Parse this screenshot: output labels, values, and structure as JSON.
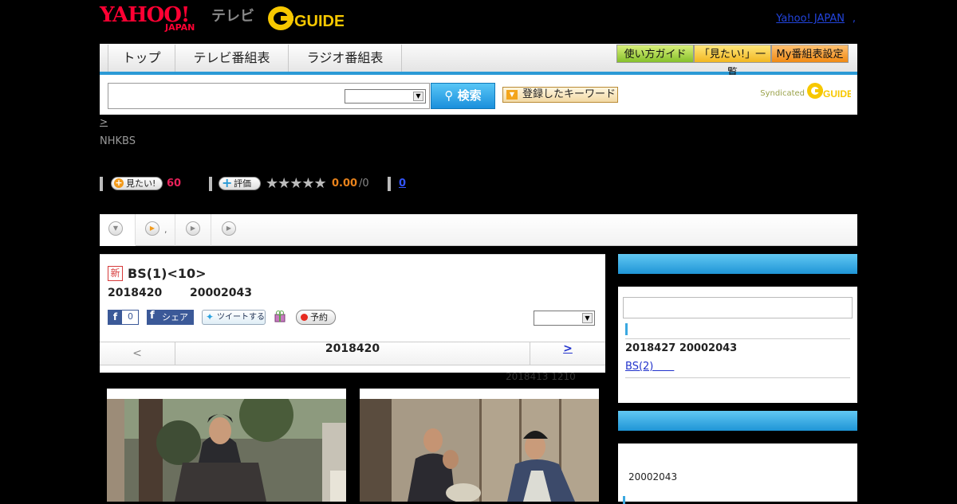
{
  "header": {
    "logo_yahoo": "YAHOO!",
    "logo_japan": "JAPAN",
    "logo_tv": "テレビ",
    "logo_gguide": "GUIDE",
    "yahoo_japan_link": "Yahoo! JAPAN",
    "yahoo_japan_dot": ","
  },
  "nav": {
    "tabs": [
      {
        "label": "トップ"
      },
      {
        "label": "テレビ番組表"
      },
      {
        "label": "ラジオ番組表"
      }
    ],
    "guide_button": "使い方ガイド",
    "mitai_list_button": "「見たい!」一覧",
    "my_schedule_button": "My番組表設定"
  },
  "search": {
    "input_value": "",
    "select_value": "",
    "search_button": "検索",
    "keyword_button": "登録したキーワード",
    "syndicated": "Syndicated"
  },
  "breadcrumb": ">",
  "station": "NHKBS",
  "ratings": {
    "mitai_label": "見たい!",
    "mitai_count": "60",
    "rate_label": "評価",
    "stars": "★★★★★",
    "score": "0.00",
    "score_den": "/0",
    "review_count": "0"
  },
  "subtabs": {
    "tab2_dot": ","
  },
  "program": {
    "new_badge": "新",
    "title": "BS(1)<10>",
    "date": "2018420",
    "time": "20002043",
    "fb_count": "0",
    "share_label": "シェア",
    "tweet_label": "ツイートする",
    "reserve_label": "予約",
    "prev": "<",
    "nav_date": "2018420",
    "next": ">",
    "rerun": "2018413  1210"
  },
  "sidebar": {
    "box1_date": "2018427  20002043",
    "box1_link": "BS(2)　　",
    "box2_time": "20002043"
  },
  "colors": {
    "accent_blue": "#2b9ad6",
    "mitai_red": "#e8215a",
    "score_orange": "#e8821b"
  }
}
